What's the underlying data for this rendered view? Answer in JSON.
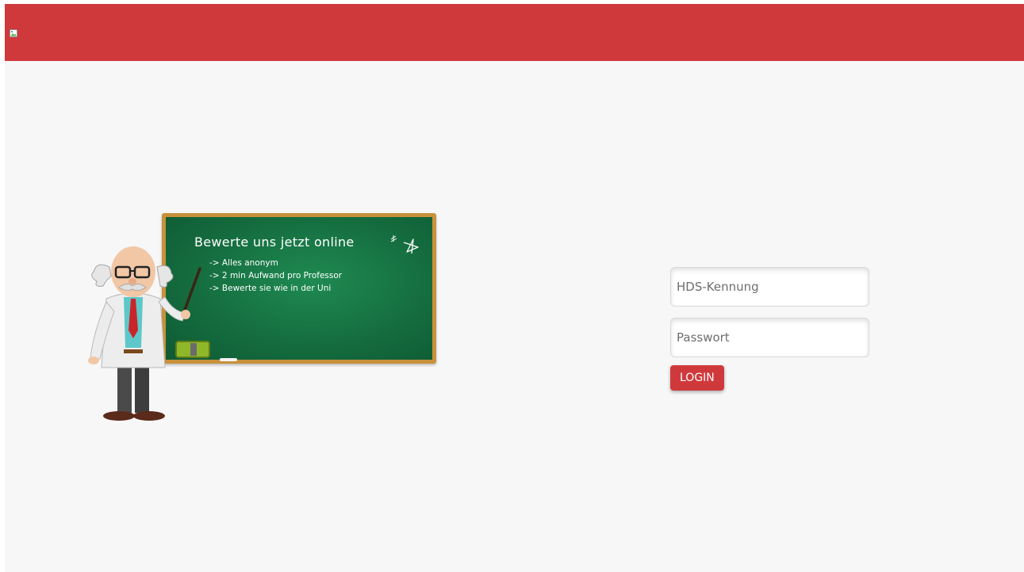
{
  "header": {
    "logo_icon": "broken-image-icon",
    "brand_color": "#d0393b"
  },
  "illustration": {
    "board_title": "Bewerte uns jetzt online",
    "board_items": [
      "-> Alles anonym",
      "-> 2 min Aufwand pro Professor",
      "-> Bewerte sie wie in der Uni"
    ],
    "icons": [
      "professor-icon",
      "eraser-icon",
      "chalk-icon",
      "sparkle-icon"
    ]
  },
  "login": {
    "username_placeholder": "HDS-Kennung",
    "password_placeholder": "Passwort",
    "button_label": "LOGIN"
  }
}
